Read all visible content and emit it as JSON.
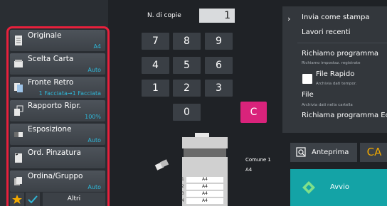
{
  "functions": [
    {
      "label": "Originale",
      "value": "A4",
      "icon": "original-icon"
    },
    {
      "label": "Scelta Carta",
      "value": "Auto",
      "icon": "paper-select-icon"
    },
    {
      "label": "Fronte Retro",
      "value": "1 Facciata→1 Facciata",
      "icon": "duplex-icon"
    },
    {
      "label": "Rapporto Ripr.",
      "value": "100%",
      "icon": "copy-ratio-icon"
    },
    {
      "label": "Esposizione",
      "value": "Auto",
      "icon": "exposure-icon"
    },
    {
      "label": "Ord. Pinzatura",
      "value": "",
      "icon": "staple-sort-icon"
    },
    {
      "label": "Ordina/Gruppo",
      "value": "Auto",
      "icon": "sort-group-icon"
    }
  ],
  "bottom": {
    "altri": "Altri"
  },
  "copies": {
    "label": "N. di copie",
    "value": "1"
  },
  "keypad": {
    "k7": "7",
    "k8": "8",
    "k9": "9",
    "k4": "4",
    "k5": "5",
    "k6": "6",
    "k1": "1",
    "k2": "2",
    "k3": "3",
    "k0": "0",
    "clear": "C"
  },
  "machine": {
    "output_label": "Comune 1",
    "output_size": "A4",
    "trays": [
      "A4",
      "A4",
      "A4",
      "A4"
    ],
    "tray_numbers": [
      "1",
      "2",
      "3",
      "4"
    ]
  },
  "right_panel": {
    "invia": "Invia come stampa",
    "lavori": "Lavori recenti",
    "richiamo": "Richiamo programma",
    "richiamo_sub": "Richiamo impostaz. registrate",
    "file_rapido": "File Rapido",
    "file_rapido_sub": "Archivia dati tempor.",
    "file": "File",
    "file_sub": "Archivia dati nella cartella",
    "richiama_eco": "Richiama programma Eco"
  },
  "actions": {
    "anteprima": "Anteprima",
    "ca": "CA",
    "avvio": "Avvio"
  },
  "colors": {
    "accent_red": "#e8203c",
    "value_blue": "#2fb7d8",
    "clear_pink": "#d9237b",
    "start_teal": "#14a3a6",
    "ca_orange": "#f2a900"
  }
}
